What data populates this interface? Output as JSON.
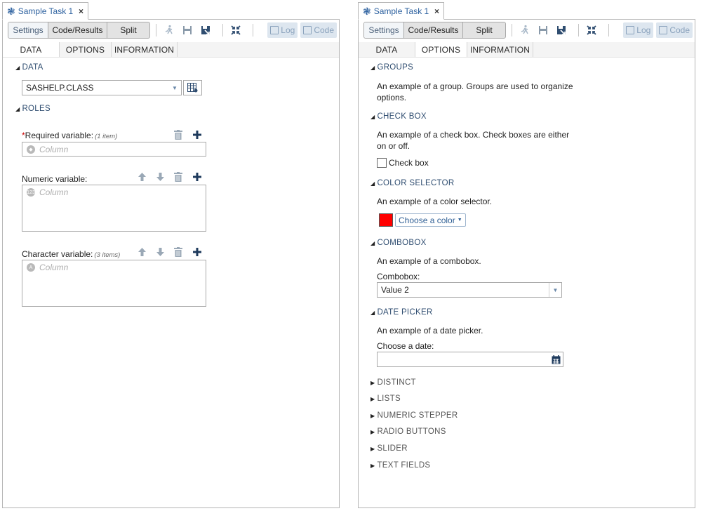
{
  "panels": [
    {
      "task_tab": {
        "title": "Sample Task 1",
        "close": "×"
      },
      "view_modes": [
        "Settings",
        "Code/Results",
        "Split"
      ],
      "log_label": "Log",
      "code_label": "Code",
      "tabs": [
        "DATA",
        "OPTIONS",
        "INFORMATION"
      ],
      "active_tab": "DATA"
    },
    {
      "task_tab": {
        "title": "Sample Task 1",
        "close": "×"
      },
      "view_modes": [
        "Settings",
        "Code/Results",
        "Split"
      ],
      "log_label": "Log",
      "code_label": "Code",
      "tabs": [
        "DATA",
        "OPTIONS",
        "INFORMATION"
      ],
      "active_tab": "OPTIONS"
    }
  ],
  "data_tab": {
    "data_section": "DATA",
    "dataset": "SASHELP.CLASS",
    "roles_section": "ROLES",
    "required_label": "Required variable:",
    "required_meta": "(1 item)",
    "numeric_label": "Numeric variable:",
    "character_label": "Character variable:",
    "character_meta": "(3 items)",
    "column_placeholder": "Column",
    "numeric_icon_text": "123"
  },
  "options_tab": {
    "groups_head": "GROUPS",
    "groups_desc_1": "An example of a group. Groups are used to organize",
    "groups_desc_2": "options.",
    "checkbox_head": "CHECK BOX",
    "checkbox_desc_1": "An example of a check box. Check boxes are either",
    "checkbox_desc_2": "on or off.",
    "checkbox_label": "Check box",
    "color_head": "COLOR SELECTOR",
    "color_desc": "An example of a color selector.",
    "color_value": "#ff0000",
    "color_button": "Choose a color",
    "combobox_head": "COMBOBOX",
    "combobox_desc": "An example of a combobox.",
    "combobox_label": "Combobox:",
    "combobox_value": "Value 2",
    "datepicker_head": "DATE PICKER",
    "datepicker_desc": "An example of a date picker.",
    "datepicker_label": "Choose a date:",
    "collapsed": [
      "DISTINCT",
      "LISTS",
      "NUMERIC STEPPER",
      "RADIO BUTTONS",
      "SLIDER",
      "TEXT FIELDS"
    ]
  },
  "colors": {
    "accent": "#2a5f9e",
    "heading": "#2f4d70"
  }
}
